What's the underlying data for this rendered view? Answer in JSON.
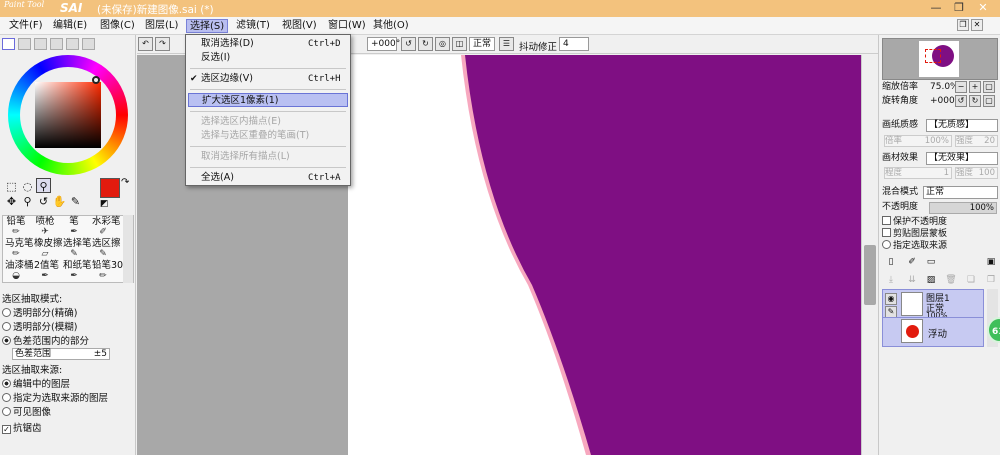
{
  "app": {
    "logo_small": "Paint Tool",
    "logo_big": "SAI",
    "title": "(未保存)新建图像.sai (*)"
  },
  "menubar": {
    "items": [
      "文件(F)",
      "编辑(E)",
      "图像(C)",
      "图层(L)",
      "选择(S)",
      "滤镜(T)",
      "视图(V)",
      "窗口(W)",
      "其他(O)"
    ],
    "active_index": 4
  },
  "dropdown": {
    "items": [
      {
        "label": "取消选择(D)",
        "shortcut": "Ctrl+D",
        "disabled": false,
        "checked": false,
        "highlighted": false
      },
      {
        "label": "反选(I)",
        "shortcut": "",
        "disabled": false,
        "checked": false,
        "highlighted": false
      },
      {
        "label": "选区边缘(V)",
        "shortcut": "Ctrl+H",
        "disabled": false,
        "checked": true,
        "highlighted": false
      },
      {
        "label": "扩大选区1像素(1)",
        "shortcut": "",
        "disabled": false,
        "checked": false,
        "highlighted": true
      },
      {
        "label": "选择选区内描点(E)",
        "shortcut": "",
        "disabled": true,
        "checked": false,
        "highlighted": false
      },
      {
        "label": "选择与选区重叠的笔画(T)",
        "shortcut": "",
        "disabled": true,
        "checked": false,
        "highlighted": false
      },
      {
        "label": "取消选择所有描点(L)",
        "shortcut": "",
        "disabled": true,
        "checked": false,
        "highlighted": false
      },
      {
        "label": "全选(A)",
        "shortcut": "Ctrl+A",
        "disabled": false,
        "checked": false,
        "highlighted": false
      }
    ]
  },
  "toolbar": {
    "rotation": "+000°",
    "blend_mode": "正常",
    "stabilizer_label": "抖动修正",
    "stabilizer_value": "4"
  },
  "brushes": {
    "row1": [
      "铅笔",
      "喷枪",
      "笔",
      "水彩笔"
    ],
    "row2": [
      "马克笔",
      "橡皮擦",
      "选择笔",
      "选区擦"
    ],
    "row3": [
      "油漆桶",
      "2值笔",
      "和纸笔",
      "铅笔30"
    ]
  },
  "selection_extract": {
    "mode_title": "选区抽取模式:",
    "modes": [
      "透明部分(精确)",
      "透明部分(模糊)",
      "色差范围内的部分"
    ],
    "mode_selected": 2,
    "range_label": "色差范围",
    "range_value": "±5",
    "source_title": "选区抽取来源:",
    "sources": [
      "编辑中的图层",
      "指定为选取来源的图层",
      "可见图像"
    ],
    "source_selected": 0,
    "antialias_label": "抗锯齿",
    "antialias_checked": true
  },
  "right_panel": {
    "zoom_label": "缩放倍率",
    "zoom_value": "75.0%",
    "rotate_label": "旋转角度",
    "rotate_value": "+000",
    "paper_texture_label": "画纸质感",
    "paper_texture_value": "【无质感】",
    "paper_scale_label": "倍率",
    "paper_scale_value": "100%",
    "paper_strength_label": "强度",
    "paper_strength_value": "20",
    "material_label": "画材效果",
    "material_value": "【无效果】",
    "material_level_label": "程度",
    "material_level_value": "1",
    "material_strength_label": "强度",
    "material_strength_value": "100",
    "blend_label": "混合模式",
    "blend_value": "正常",
    "opacity_label": "不透明度",
    "opacity_value": "100%",
    "checks": [
      "保护不透明度",
      "剪贴图层蒙板",
      "指定选取来源"
    ]
  },
  "layers": [
    {
      "name": "图层1",
      "mode": "正常",
      "opacity": "100%"
    },
    {
      "name": "浮动"
    }
  ],
  "badge": "61",
  "colors": {
    "primary": "#e21b0e",
    "secondary": "#f6c9bf",
    "canvas_shape": "#7f0f83",
    "menu_highlight": "#b9c0f2"
  }
}
